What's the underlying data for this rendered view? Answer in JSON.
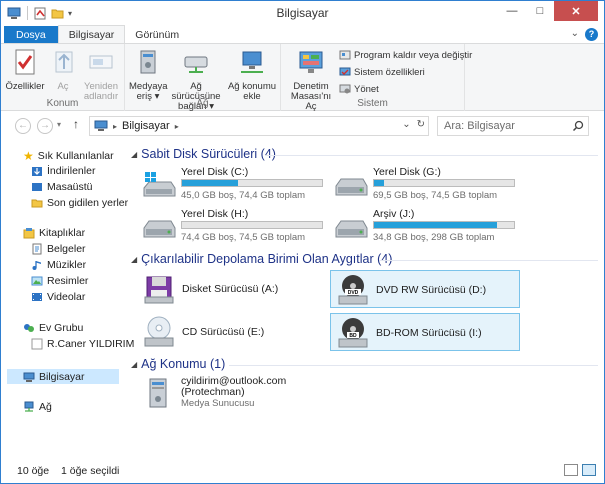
{
  "window": {
    "title": "Bilgisayar",
    "controls": {
      "minimize": "—",
      "maximize": "□",
      "close": "✕"
    }
  },
  "ribbon_tabs": {
    "file": "Dosya",
    "computer": "Bilgisayar",
    "view": "Görünüm"
  },
  "ribbon": {
    "konum": {
      "label": "Konum",
      "properties": "Özellikler",
      "open": "Aç",
      "rename_l1": "Yeniden",
      "rename_l2": "adlandır"
    },
    "ag": {
      "label": "Ağ",
      "media_l1": "Medyaya",
      "media_l2": "eriş ▾",
      "map_l1": "Ağ sürücüsüne",
      "map_l2": "bağlan ▾",
      "addloc_l1": "Ağ konumu",
      "addloc_l2": "ekle"
    },
    "sistem": {
      "label": "Sistem",
      "cp_l1": "Denetim",
      "cp_l2": "Masası'nı Aç",
      "uninstall": "Program kaldır veya değiştir",
      "sysprops": "Sistem özellikleri",
      "manage": "Yönet"
    }
  },
  "address": {
    "path": "Bilgisayar",
    "search_placeholder": "Ara: Bilgisayar"
  },
  "nav": {
    "favorites": "Sık Kullanılanlar",
    "downloads": "İndirilenler",
    "desktop": "Masaüstü",
    "recent": "Son gidilen yerler",
    "libraries": "Kitaplıklar",
    "documents": "Belgeler",
    "music": "Müzikler",
    "pictures": "Resimler",
    "videos": "Videolar",
    "homegroup": "Ev Grubu",
    "user": "R.Caner YILDIRIM",
    "computer": "Bilgisayar",
    "network": "Ağ"
  },
  "groups": {
    "hdd": "Sabit Disk Sürücüleri (4)",
    "removable": "Çıkarılabilir Depolama Birimi Olan Aygıtlar (4)",
    "netloc": "Ağ Konumu (1)"
  },
  "drives": [
    {
      "name": "Yerel Disk (C:)",
      "info": "45,0 GB boş, 74,4 GB toplam",
      "used_fraction": 0.4
    },
    {
      "name": "Yerel Disk (G:)",
      "info": "69,5 GB boş, 74,5 GB toplam",
      "used_fraction": 0.07
    },
    {
      "name": "Yerel Disk (H:)",
      "info": "74,4 GB boş, 74,5 GB toplam",
      "used_fraction": 0.0
    },
    {
      "name": "Arşiv (J:)",
      "info": "34,8 GB boş, 298 GB toplam",
      "used_fraction": 0.88
    }
  ],
  "devices": [
    {
      "name": "Disket Sürücüsü (A:)"
    },
    {
      "name": "DVD RW Sürücüsü (D:)"
    },
    {
      "name": "CD Sürücüsü (E:)"
    },
    {
      "name": "BD-ROM Sürücüsü (I:)"
    }
  ],
  "network_location": {
    "line1": "cyildirim@outlook.com",
    "line2": "(Protechman)",
    "line3": "Medya Sunucusu"
  },
  "status": {
    "count": "10 öğe",
    "selected": "1 öğe seçildi"
  },
  "colors": {
    "accent": "#1979ca",
    "bar_fill": "#26a0da",
    "group_heading": "#1e3287",
    "selection": "#e5f3fb"
  }
}
